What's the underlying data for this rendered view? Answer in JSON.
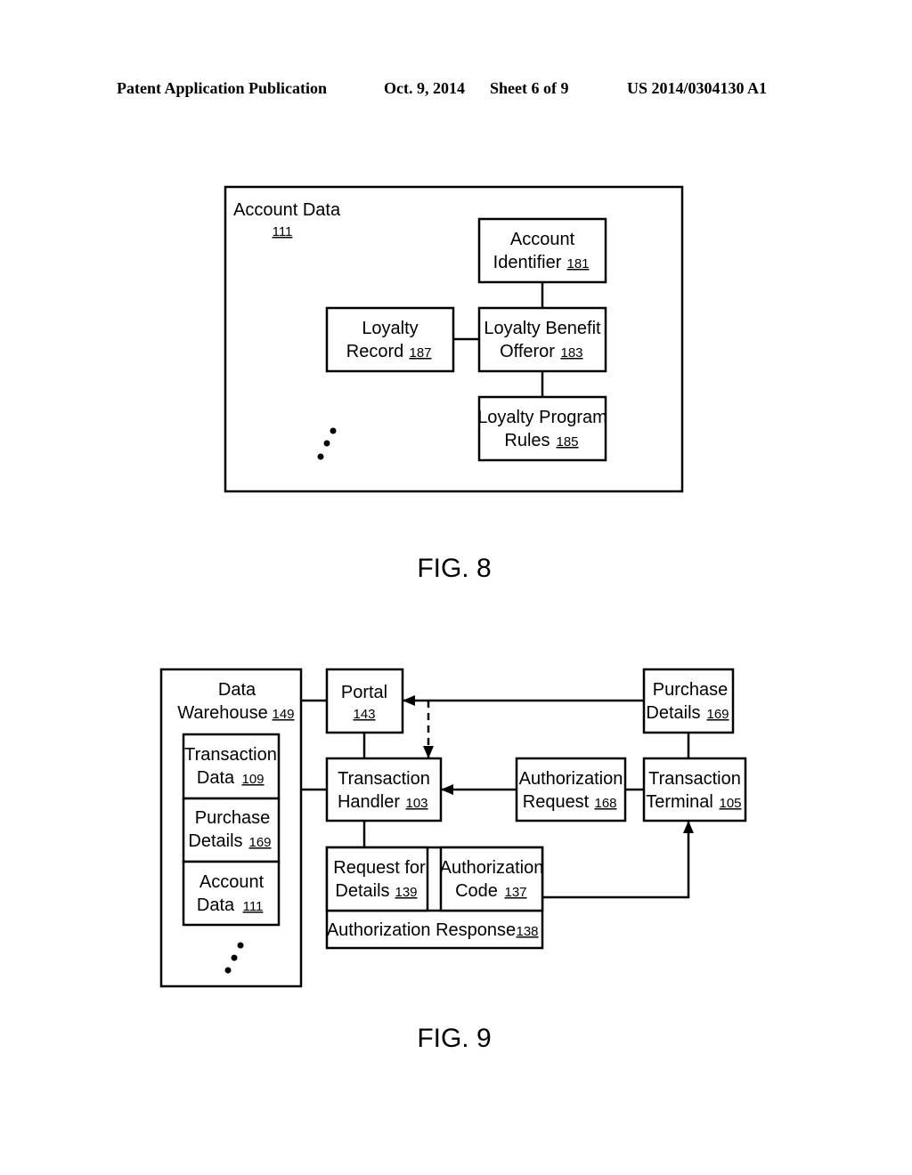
{
  "header": {
    "publication": "Patent Application Publication",
    "date": "Oct. 9, 2014",
    "sheet": "Sheet 6 of 9",
    "number": "US 2014/0304130 A1"
  },
  "fig8": {
    "caption": "FIG. 8",
    "container": {
      "line1": "Account Data",
      "ref": "111"
    },
    "account_identifier": {
      "line1": "Account",
      "line2": "Identifier",
      "ref": "181"
    },
    "loyalty_record": {
      "line1": "Loyalty",
      "line2": "Record",
      "ref": "187"
    },
    "loyalty_benefit_offeror": {
      "line1": "Loyalty Benefit",
      "line2": "Offeror",
      "ref": "183"
    },
    "loyalty_program_rules": {
      "line1": "Loyalty Program",
      "line2": "Rules",
      "ref": "185"
    }
  },
  "fig9": {
    "caption": "FIG. 9",
    "data_warehouse": {
      "line1": "Data",
      "line2": "Warehouse",
      "ref": "149"
    },
    "transaction_data": {
      "line1": "Transaction",
      "line2": "Data",
      "ref": "109"
    },
    "dw_purchase_details": {
      "line1": "Purchase",
      "line2": "Details",
      "ref": "169"
    },
    "dw_account_data": {
      "line1": "Account",
      "line2": "Data",
      "ref": "111"
    },
    "portal": {
      "line1": "Portal",
      "ref": "143"
    },
    "transaction_handler": {
      "line1": "Transaction",
      "line2": "Handler",
      "ref": "103"
    },
    "purchase_details": {
      "line1": "Purchase",
      "line2": "Details",
      "ref": "169"
    },
    "authorization_request": {
      "line1": "Authorization",
      "line2": "Request",
      "ref": "168"
    },
    "transaction_terminal": {
      "line1": "Transaction",
      "line2": "Terminal",
      "ref": "105"
    },
    "request_for_details": {
      "line1": "Request for",
      "line2": "Details",
      "ref": "139"
    },
    "authorization_code": {
      "line1": "Authorization",
      "line2": "Code",
      "ref": "137"
    },
    "authorization_response": {
      "line1": "Authorization Response",
      "ref": "138"
    }
  }
}
